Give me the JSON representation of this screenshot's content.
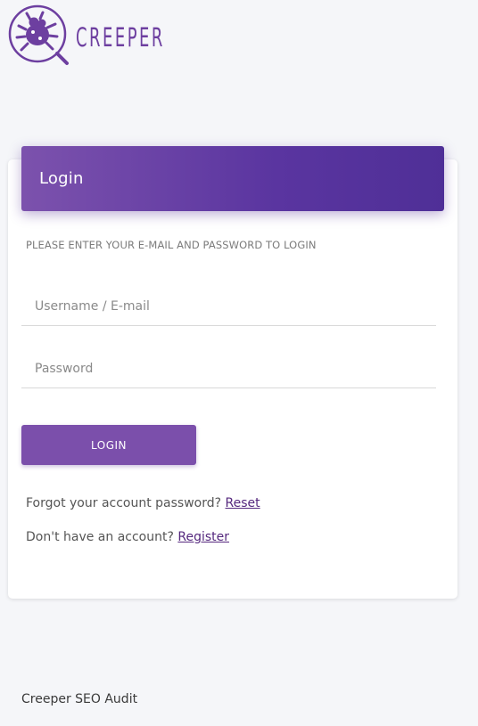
{
  "brand": {
    "name": "CREEPER",
    "logo_icon": "bug-magnifier-icon",
    "color": "#6d3fa0"
  },
  "login": {
    "title": "Login",
    "instructions": "PLEASE ENTER YOUR E-MAIL AND PASSWORD TO LOGIN",
    "username_placeholder": "Username / E-mail",
    "username_value": "",
    "password_placeholder": "Password",
    "password_value": "",
    "button_label": "LOGIN",
    "forgot_text": "Forgot your account password?",
    "forgot_link": "Reset",
    "register_text": "Don't have an account?",
    "register_link": "Register",
    "header_color": "#5a35a0",
    "button_color": "#7b4fab",
    "link_color": "#55287e"
  },
  "footer": {
    "text": "Creeper SEO Audit"
  }
}
